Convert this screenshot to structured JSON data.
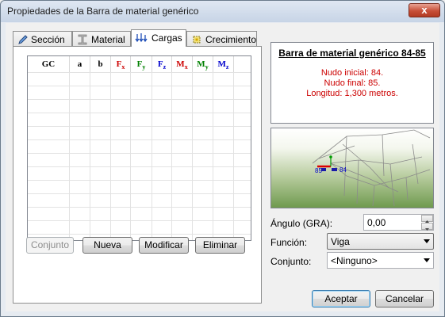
{
  "window": {
    "title": "Propiedades de la Barra de material genérico",
    "close_glyph": "x"
  },
  "tabs": [
    {
      "label": "Sección",
      "icon": "pencil-icon"
    },
    {
      "label": "Material",
      "icon": "ibeam-icon"
    },
    {
      "label": "Cargas",
      "icon": "loads-arrows-icon",
      "active": true
    },
    {
      "label": "Crecimiento",
      "icon": "growth-icon"
    }
  ],
  "grid": {
    "columns": [
      {
        "main": "GC",
        "sub": "",
        "color": "#000000"
      },
      {
        "main": "a",
        "sub": "",
        "color": "#000000"
      },
      {
        "main": "b",
        "sub": "",
        "color": "#000000"
      },
      {
        "main": "F",
        "sub": "x",
        "color": "#cc0000"
      },
      {
        "main": "F",
        "sub": "y",
        "color": "#008000"
      },
      {
        "main": "F",
        "sub": "z",
        "color": "#0000cc"
      },
      {
        "main": "M",
        "sub": "x",
        "color": "#cc0000"
      },
      {
        "main": "M",
        "sub": "y",
        "color": "#008000"
      },
      {
        "main": "M",
        "sub": "z",
        "color": "#0000cc"
      }
    ]
  },
  "buttons": {
    "conjunto": "Conjunto",
    "nueva": "Nueva",
    "modificar": "Modificar",
    "eliminar": "Eliminar",
    "aceptar": "Aceptar",
    "cancelar": "Cancelar"
  },
  "info": {
    "title": "Barra de material genérico 84-85",
    "nudo_inicial": "Nudo inicial: 84.",
    "nudo_final": "Nudo final: 85.",
    "longitud": "Longitud: 1,300 metros."
  },
  "preview": {
    "node_a": "85",
    "node_b": "84"
  },
  "form": {
    "angulo_label": "Ángulo (GRA):",
    "angulo_value": "0,00",
    "funcion_label": "Función:",
    "funcion_value": "Viga",
    "conjunto_label": "Conjunto:",
    "conjunto_value": "<Ninguno>"
  }
}
